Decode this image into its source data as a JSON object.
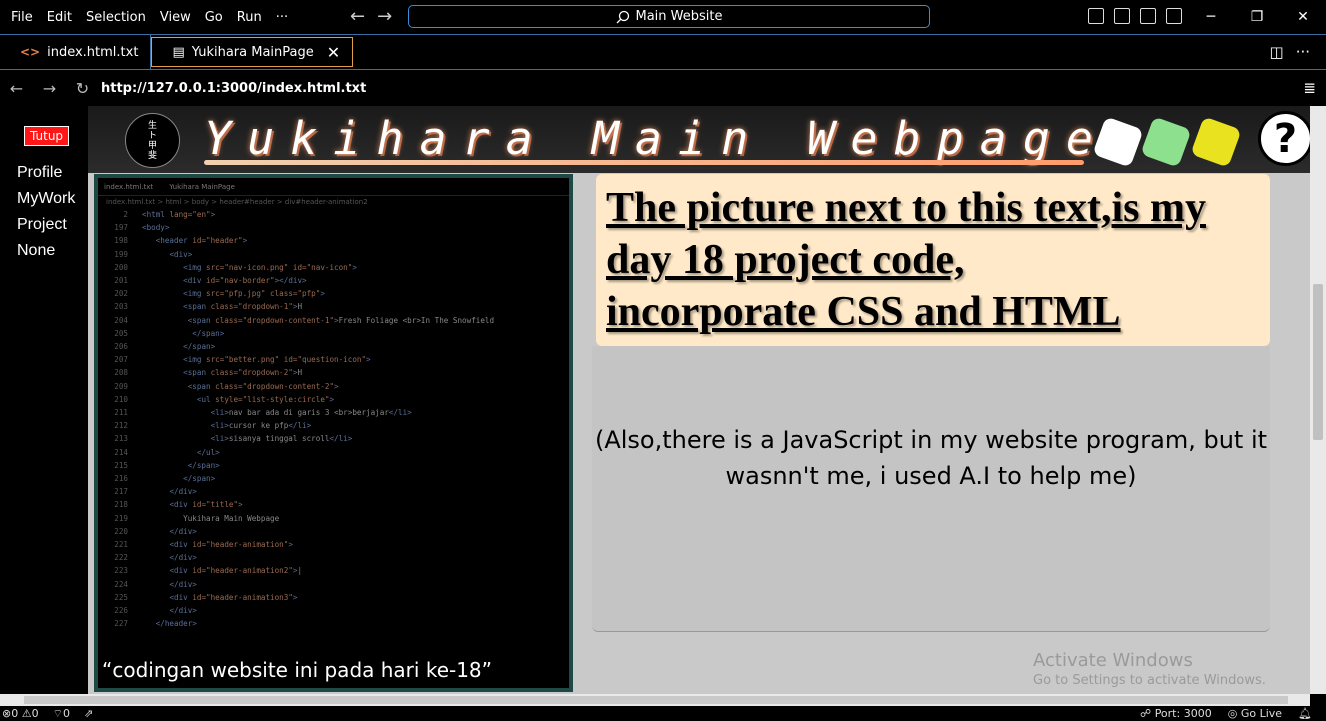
{
  "menu": [
    "File",
    "Edit",
    "Selection",
    "View",
    "Go",
    "Run",
    "···"
  ],
  "command_center": "Main Website",
  "tabs": [
    {
      "label": "index.html.txt",
      "active": false
    },
    {
      "label": "Yukihara MainPage",
      "active": true
    }
  ],
  "address": {
    "url": "http://127.0.0.1:3000/index.html.txt"
  },
  "sidebar": {
    "close_label": "Tutup",
    "items": [
      "Profile",
      "MyWork",
      "Project",
      "None"
    ]
  },
  "header": {
    "title": "Yukihara Main Webpage",
    "help_symbol": "?",
    "square_colors": [
      "#ffffff",
      "#8de08d",
      "#e8e21f"
    ]
  },
  "code_panel": {
    "tabs": [
      "index.html.txt",
      "Yukihara MainPage"
    ],
    "breadcrumbs": "index.html.txt > html > body > header#header > div#header-animation2",
    "caption": "“codingan website ini pada hari ke-18”"
  },
  "main": {
    "heading_lines": [
      "The picture next to this text,is my",
      "day 18 project code,",
      "incorporate CSS and HTML"
    ],
    "note": "(Also,there is a JavaScript in my website program, but it wasnn't me, i used A.I to help me)"
  },
  "watermark": {
    "title": "Activate Windows",
    "subtitle": "Go to Settings to activate Windows."
  },
  "status": {
    "errors": "0",
    "warnings": "0",
    "ports_forwarded": "0",
    "port": "Port: 3000",
    "go_live": "Go Live"
  }
}
